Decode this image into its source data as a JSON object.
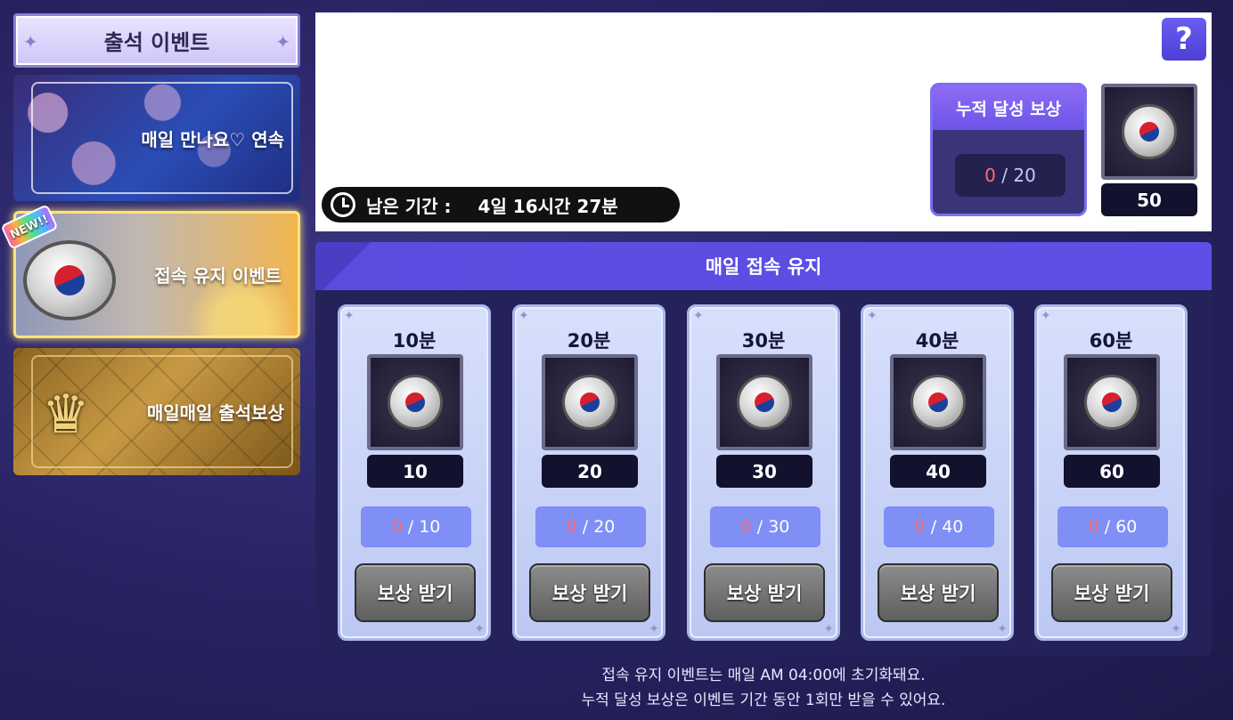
{
  "sidebar": {
    "title": "출석 이벤트",
    "items": [
      {
        "label": "매일 만나요♡ 연속"
      },
      {
        "label": "접속 유지 이벤트",
        "badge": "NEW!!"
      },
      {
        "label": "매일매일 출석보상"
      }
    ]
  },
  "top": {
    "remaining_label": "남은 기간 :",
    "remaining_value": "4일 16시간 27분",
    "help_label": "?",
    "cumulative": {
      "title": "누적 달성 보상",
      "current": "0",
      "target": "/ 20",
      "reward_count": "50"
    }
  },
  "main": {
    "title": "매일 접속 유지",
    "rewards": [
      {
        "time": "10분",
        "count": "10",
        "current": "0",
        "target": "/ 10",
        "button": "보상 받기"
      },
      {
        "time": "20분",
        "count": "20",
        "current": "0",
        "target": "/ 20",
        "button": "보상 받기"
      },
      {
        "time": "30분",
        "count": "30",
        "current": "0",
        "target": "/ 30",
        "button": "보상 받기"
      },
      {
        "time": "40분",
        "count": "40",
        "current": "0",
        "target": "/ 40",
        "button": "보상 받기"
      },
      {
        "time": "60분",
        "count": "60",
        "current": "0",
        "target": "/ 60",
        "button": "보상 받기"
      }
    ]
  },
  "footer": {
    "line1": "접속 유지 이벤트는 매일 AM 04:00에 초기화돼요.",
    "line2": "누적 달성 보상은 이벤트 기간 동안 1회만 받을 수 있어요."
  }
}
